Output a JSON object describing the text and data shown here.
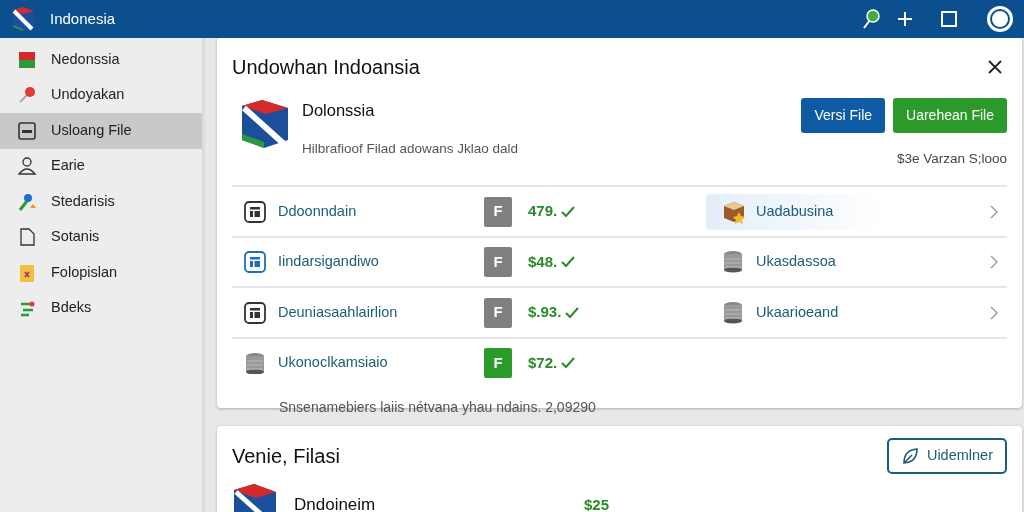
{
  "app_bar": {
    "title": "Indonesia"
  },
  "sidebar": {
    "items": [
      {
        "label": "Nedonssia",
        "selected": false
      },
      {
        "label": "Undoyakan",
        "selected": false
      },
      {
        "label": "Usloang File",
        "selected": true
      },
      {
        "label": "Earie",
        "selected": false
      },
      {
        "label": "Stedarisis",
        "selected": false
      },
      {
        "label": "Sotanis",
        "selected": false
      },
      {
        "label": "Folopislan",
        "selected": false
      },
      {
        "label": "Bdeks",
        "selected": false
      }
    ]
  },
  "dialog": {
    "title": "Undowhan Indoansia",
    "app_name": "Dolonssia",
    "description": "Hilbrafioof Filad adowans Jklao dald",
    "buttons": [
      {
        "label": "Versi File",
        "kind": "primary"
      },
      {
        "label": "Uarehean File",
        "kind": "success"
      }
    ],
    "version": "$3e Varzan S;looo",
    "rows": [
      {
        "name": "Ddoonndain",
        "badge": "F",
        "color": "#808080",
        "price": "479.",
        "side": {
          "name": "Uadabusina",
          "selected": true
        }
      },
      {
        "name": "Iindarsigandiwo",
        "badge": "F",
        "color": "#808080",
        "price": "$48.",
        "side": {
          "name": "Ukasdassoa",
          "selected": false
        }
      },
      {
        "name": "Deuniasaahlairlion",
        "badge": "F",
        "color": "#808080",
        "price": "$.93.",
        "side": {
          "name": "Ukaarioeand",
          "selected": false
        }
      },
      {
        "name": "Ukonoclkamsiaio",
        "badge": "F",
        "color": "#2a9a2a",
        "price": "$72."
      }
    ],
    "footer": "Snsenamebiers laiis nétvana yhau ndains. 2,09290"
  },
  "second_card": {
    "title": "Venie, Filasi",
    "button": "Uidemlner",
    "rows": [
      {
        "name": "Dndoineim",
        "price": "$25"
      }
    ]
  }
}
